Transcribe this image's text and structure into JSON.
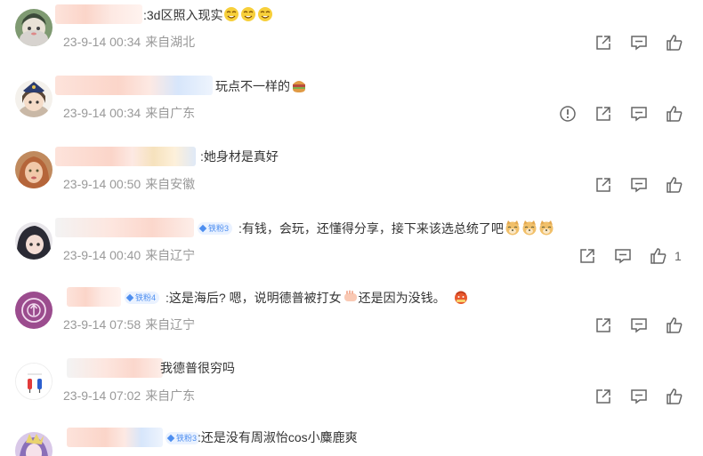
{
  "comments": [
    {
      "text": ":3d区照入现实",
      "date": "23-9-14 00:34",
      "location": "来自湖北",
      "emojis": [
        "smile-emoji",
        "smile-emoji",
        "smile-emoji"
      ]
    },
    {
      "text": "玩点不一样的",
      "date": "23-9-14 00:34",
      "location": "来自广东",
      "emojis": [
        "hamburger-emoji"
      ]
    },
    {
      "text": ":她身材是真好",
      "date": "23-9-14 00:50",
      "location": "来自安徽",
      "emojis": []
    },
    {
      "badge": "铁粉3",
      "text": ":有钱，会玩，还懂得分享，接下来该选总统了吧",
      "date": "23-9-14 00:40",
      "location": "来自辽宁",
      "like_count": "1",
      "emojis": [
        "doge-emoji",
        "doge-emoji",
        "doge-emoji"
      ]
    },
    {
      "badge": "铁粉4",
      "text": ":这是海后? 嗯，说明德普被打女",
      "text_tail": "还是因为没钱。",
      "date": "23-9-14 07:58",
      "location": "来自辽宁",
      "emojis": [
        "hand-emoji",
        "spicy-emoji"
      ]
    },
    {
      "text": "我德普很穷吗",
      "date": "23-9-14 07:02",
      "location": "来自广东",
      "emojis": []
    },
    {
      "badge": "铁粉3",
      "text": ":还是没有周淑怡cos小麋鹿爽",
      "emojis": []
    }
  ],
  "icons": {
    "share": "share-icon",
    "reply": "comment-icon",
    "like": "like-icon",
    "report": "report-icon"
  },
  "colors": {
    "badge_text": "#4d8ef0",
    "badge_bg": "#eaf2ff",
    "meta": "#999999",
    "icon": "#666666"
  }
}
